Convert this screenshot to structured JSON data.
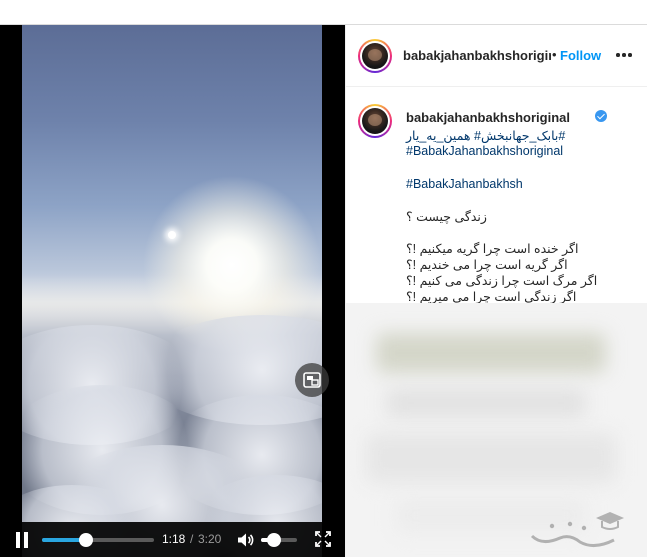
{
  "post": {
    "username": "babakjahanbakhshoriginal",
    "header_username": "babakjahanbakhshorigir",
    "dot": "•",
    "follow_label": "Follow",
    "caption_lines": [
      "بابک_جهانبخش# همین_یه_یار#",
      "#BabakJahanbakhshoriginal",
      "",
      "#BabakJahanbakhsh",
      "",
      "زندگی چیست ؟",
      "",
      "اگر خنده است چرا گریه میکنیم !؟",
      "اگر گریه است چرا می خندیم !؟",
      "اگر مرگ است چرا زندگی می کنیم !؟",
      "اگر زندگی است چرا می میریم !؟"
    ]
  },
  "video": {
    "current_time": "1:18",
    "separator": "/",
    "total_time": "3:20",
    "progress_fraction": 0.39,
    "volume_fraction": 0.37
  },
  "icons": {
    "pause": "pause-icon",
    "volume": "volume-icon",
    "fullscreen": "fullscreen-icon",
    "pip": "picture-in-picture-icon",
    "more": "more-options-icon",
    "verified": "verified-badge-icon"
  },
  "colors": {
    "follow": "#0095f6",
    "progress": "#2aa6e0",
    "hashtag": "#00376b",
    "verified": "#3897f0"
  }
}
